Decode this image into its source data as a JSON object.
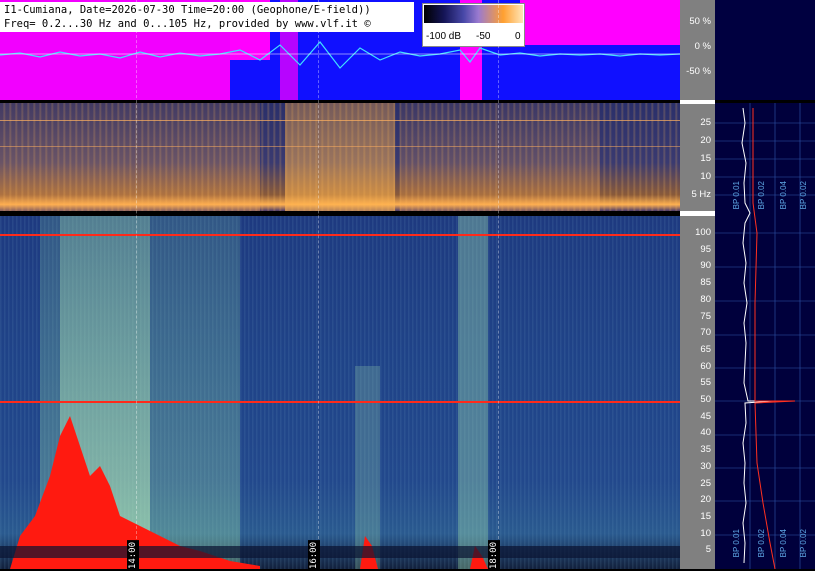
{
  "header": {
    "line1": "I1-Cumiana, Date=2026-07-30 Time=20:00 (Geophone/E-field))",
    "line2": "Freq= 0.2...30 Hz and 0...105 Hz, provided by www.vlf.it ©"
  },
  "colorbar": {
    "labels": [
      "-100 dB",
      "-50",
      "0"
    ]
  },
  "amplitude_axis": {
    "labels": [
      "50 %",
      "0 %",
      "-50 %"
    ]
  },
  "low_freq_axis": {
    "labels": [
      "25",
      "20",
      "15",
      "10",
      "5 Hz"
    ]
  },
  "high_freq_axis": {
    "labels": [
      "100",
      "95",
      "90",
      "85",
      "80",
      "75",
      "70",
      "65",
      "60",
      "55",
      "50",
      "45",
      "40",
      "35",
      "30",
      "25",
      "20",
      "15",
      "10",
      "5"
    ]
  },
  "time_labels": [
    "14:00",
    "16:00",
    "18:00"
  ],
  "bp_labels_low": [
    "BP 0.01",
    "BP 0.02",
    "BP 0.04",
    "BP 0.02"
  ],
  "bp_labels_high": [
    "BP 0.01",
    "BP 0.02",
    "BP 0.04",
    "BP 0.02"
  ],
  "colors": {
    "amplitude_bg": "#1010ff",
    "amplitude_clip": "#ff00ff",
    "signal": "#40e0ff",
    "powerline": "#ff2a1a",
    "axis_bg": "#808080",
    "right_bg": "#00003c"
  }
}
